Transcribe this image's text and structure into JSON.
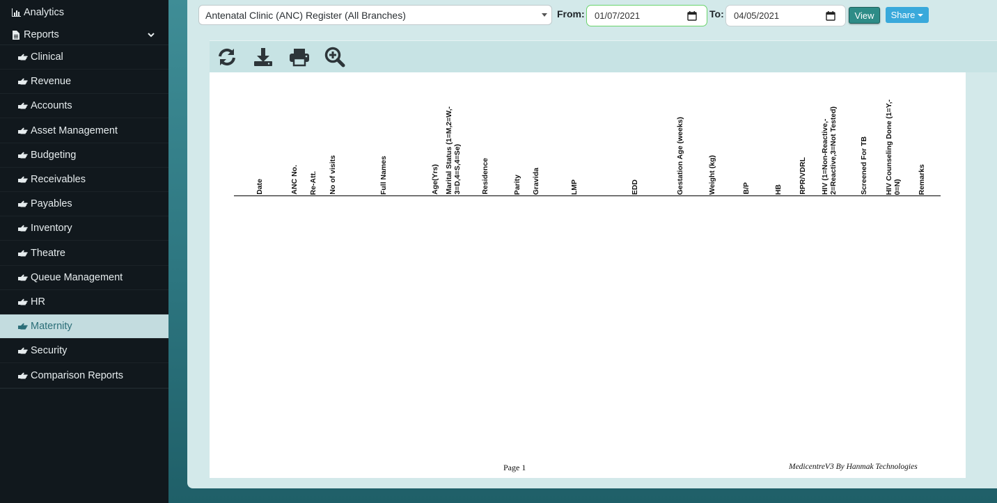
{
  "sidebar": {
    "top_items": [
      {
        "label": "Analytics",
        "icon": "bar-chart-icon"
      },
      {
        "label": "Reports",
        "icon": "document-icon"
      }
    ],
    "sub_items": [
      {
        "label": "Clinical"
      },
      {
        "label": "Revenue"
      },
      {
        "label": "Accounts"
      },
      {
        "label": "Asset Management"
      },
      {
        "label": "Budgeting"
      },
      {
        "label": "Receivables"
      },
      {
        "label": "Payables"
      },
      {
        "label": "Inventory"
      },
      {
        "label": "Theatre"
      },
      {
        "label": "Queue Management"
      },
      {
        "label": "HR"
      },
      {
        "label": "Maternity",
        "active": true
      },
      {
        "label": "Security"
      },
      {
        "label": "Comparison Reports"
      }
    ]
  },
  "filters": {
    "report_selected": "Antenatal Clinic (ANC) Register (All Branches)",
    "from_label": "From:",
    "from_value": "01/07/2021",
    "to_label": "To:",
    "to_value": "04/05/2021",
    "view_label": "View",
    "share_label": "Share"
  },
  "toolbar": {
    "icons": [
      "refresh-icon",
      "download-icon",
      "print-icon",
      "zoom-in-icon"
    ]
  },
  "report": {
    "columns": [
      "Date",
      "ANC No.",
      "Re-Att.",
      "No of visits",
      "Full Names",
      "Age(Yrs)",
      "Marital Status (1=M,2=W,-\n3=D,4=S,4=Se)",
      "Residence",
      "Parity",
      "Gravida",
      "LMP",
      "EDD",
      "Gestation Age (weeks)",
      "Weight (kg)",
      "B/P",
      "HB",
      "RPR/VDRL",
      "HIV (1=Non-Reactive,-\n2=Reactive,3=Not Tested)",
      "Screened For TB",
      "HIV Counseling Done (1=Y,-\n0=N)",
      "Remarks"
    ],
    "footer_page": "Page 1",
    "footer_brand": "MedicentreV3 By Hanmak Technologies"
  },
  "colors": {
    "sidebar_bg": "#11181d",
    "active_bg": "#c3dcdf",
    "panel_bg": "#d3e9ea",
    "view_btn": "#2e8c87",
    "share_btn": "#39a9db"
  }
}
